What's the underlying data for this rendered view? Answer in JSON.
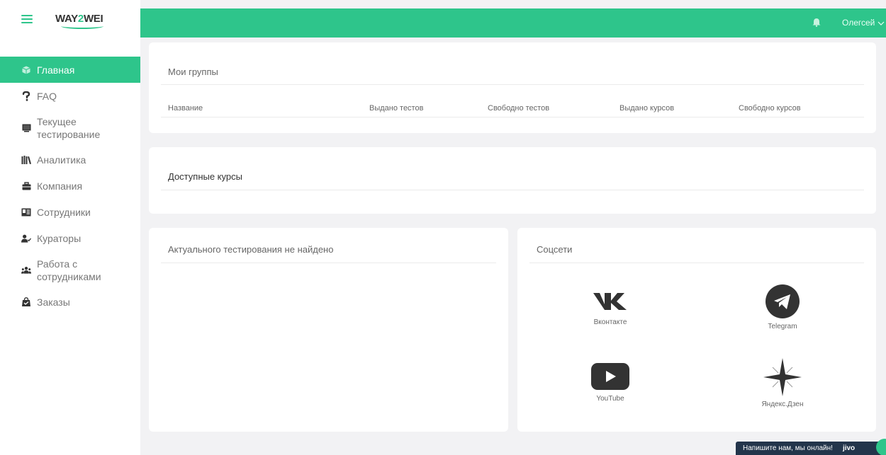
{
  "brand": {
    "logo_prefix": "WAY",
    "logo_two": "2",
    "logo_suffix": "WEI",
    "accent": "#2ec58b"
  },
  "sidebar": {
    "items": [
      {
        "label": "Главная",
        "icon": "cube-icon",
        "active": true
      },
      {
        "label": "FAQ",
        "icon": "question-icon"
      },
      {
        "label_lines": [
          "Текущее",
          "тестирование"
        ],
        "icon": "monitor-icon"
      },
      {
        "label": "Аналитика",
        "icon": "books-icon"
      },
      {
        "label": "Компания",
        "icon": "briefcase-icon"
      },
      {
        "label": "Сотрудники",
        "icon": "contact-card-icon"
      },
      {
        "label": "Кураторы",
        "icon": "user-check-icon"
      },
      {
        "label_lines": [
          "Работа с",
          "сотрудниками"
        ],
        "icon": "users-icon"
      },
      {
        "label": "Заказы",
        "icon": "shopping-bag-icon"
      }
    ]
  },
  "header": {
    "user_name": "Олегсей"
  },
  "groups": {
    "title": "Мои группы",
    "columns": [
      "Название",
      "Выдано тестов",
      "Свободно тестов",
      "Выдано курсов",
      "Свободно курсов"
    ]
  },
  "courses": {
    "title": "Доступные курсы"
  },
  "testing": {
    "title": "Актуального тестирования не найдено"
  },
  "social": {
    "title": "Соцсети",
    "links": [
      {
        "label": "Вконтакте",
        "icon": "vk-icon"
      },
      {
        "label": "Telegram",
        "icon": "telegram-icon"
      },
      {
        "label": "YouTube",
        "icon": "youtube-icon"
      },
      {
        "label": "Яндекс.Дзен",
        "icon": "zen-icon"
      }
    ]
  },
  "chat": {
    "text": "Напишите нам, мы онлайн!",
    "brand": "jivo"
  }
}
